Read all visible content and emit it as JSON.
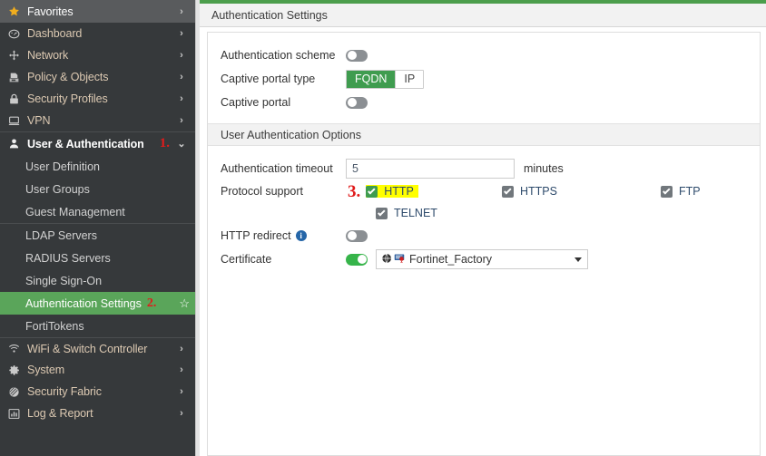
{
  "sidebar": {
    "top_items": [
      {
        "label": "Favorites",
        "icon": "star-icon",
        "chevron": "›",
        "state": "highlighted"
      },
      {
        "label": "Dashboard",
        "icon": "dashboard-gauge-icon",
        "chevron": "›",
        "state": "normal"
      },
      {
        "label": "Network",
        "icon": "network-arrows-icon",
        "chevron": "›",
        "state": "normal"
      },
      {
        "label": "Policy & Objects",
        "icon": "policy-icon",
        "chevron": "›",
        "state": "normal"
      },
      {
        "label": "Security Profiles",
        "icon": "lock-icon",
        "chevron": "›",
        "state": "normal"
      },
      {
        "label": "VPN",
        "icon": "monitor-icon",
        "chevron": "›",
        "state": "normal"
      }
    ],
    "expanded_item": {
      "label": "User & Authentication",
      "icon": "user-icon",
      "chevron": "⌄",
      "annotation": "1."
    },
    "sub_items": [
      {
        "label": "User Definition",
        "selected": false
      },
      {
        "label": "User Groups",
        "selected": false
      },
      {
        "label": "Guest Management",
        "selected": false
      },
      {
        "label": "LDAP Servers",
        "selected": false
      },
      {
        "label": "RADIUS Servers",
        "selected": false
      },
      {
        "label": "Single Sign-On",
        "selected": false
      },
      {
        "label": "Authentication Settings",
        "selected": true,
        "annotation": "2.",
        "star": "☆"
      },
      {
        "label": "FortiTokens",
        "selected": false
      }
    ],
    "bottom_items": [
      {
        "label": "WiFi & Switch Controller",
        "icon": "wifi-icon",
        "chevron": "›"
      },
      {
        "label": "System",
        "icon": "gear-icon",
        "chevron": "›"
      },
      {
        "label": "Security Fabric",
        "icon": "fabric-icon",
        "chevron": "›"
      },
      {
        "label": "Log & Report",
        "icon": "chart-bar-icon",
        "chevron": "›"
      }
    ]
  },
  "header": {
    "title": "Authentication Settings"
  },
  "main": {
    "auth_scheme": {
      "label": "Authentication scheme",
      "toggle_state": "off"
    },
    "captive_portal_type": {
      "label": "Captive portal type",
      "options": [
        "FQDN",
        "IP"
      ],
      "selected": "FQDN"
    },
    "captive_portal": {
      "label": "Captive portal",
      "toggle_state": "off"
    },
    "section_title": "User Authentication Options",
    "auth_timeout": {
      "label": "Authentication timeout",
      "value": "5",
      "placeholder": "",
      "unit": "minutes"
    },
    "protocol_support": {
      "label": "Protocol support",
      "annotation": "3.",
      "items": [
        {
          "label": "HTTP",
          "checked": true,
          "highlighted": true,
          "accent": "green"
        },
        {
          "label": "HTTPS",
          "checked": true,
          "highlighted": false,
          "accent": "gray"
        },
        {
          "label": "FTP",
          "checked": true,
          "highlighted": false,
          "accent": "gray"
        },
        {
          "label": "TELNET",
          "checked": true,
          "highlighted": false,
          "accent": "gray"
        }
      ]
    },
    "http_redirect": {
      "label": "HTTP redirect",
      "info_icon": "info-icon",
      "toggle_state": "off"
    },
    "certificate": {
      "label": "Certificate",
      "toggle_state": "on",
      "value": "Fortinet_Factory",
      "icons": [
        "globe-icon",
        "certificate-icon"
      ]
    }
  },
  "colors": {
    "accent_green": "#3f9c4f",
    "sidebar_bg": "#36393b",
    "selected_green": "#5aa55a",
    "annotation_red": "#e01b1b",
    "highlight_yellow": "#ffff00",
    "toggle_on": "#36b44a"
  }
}
